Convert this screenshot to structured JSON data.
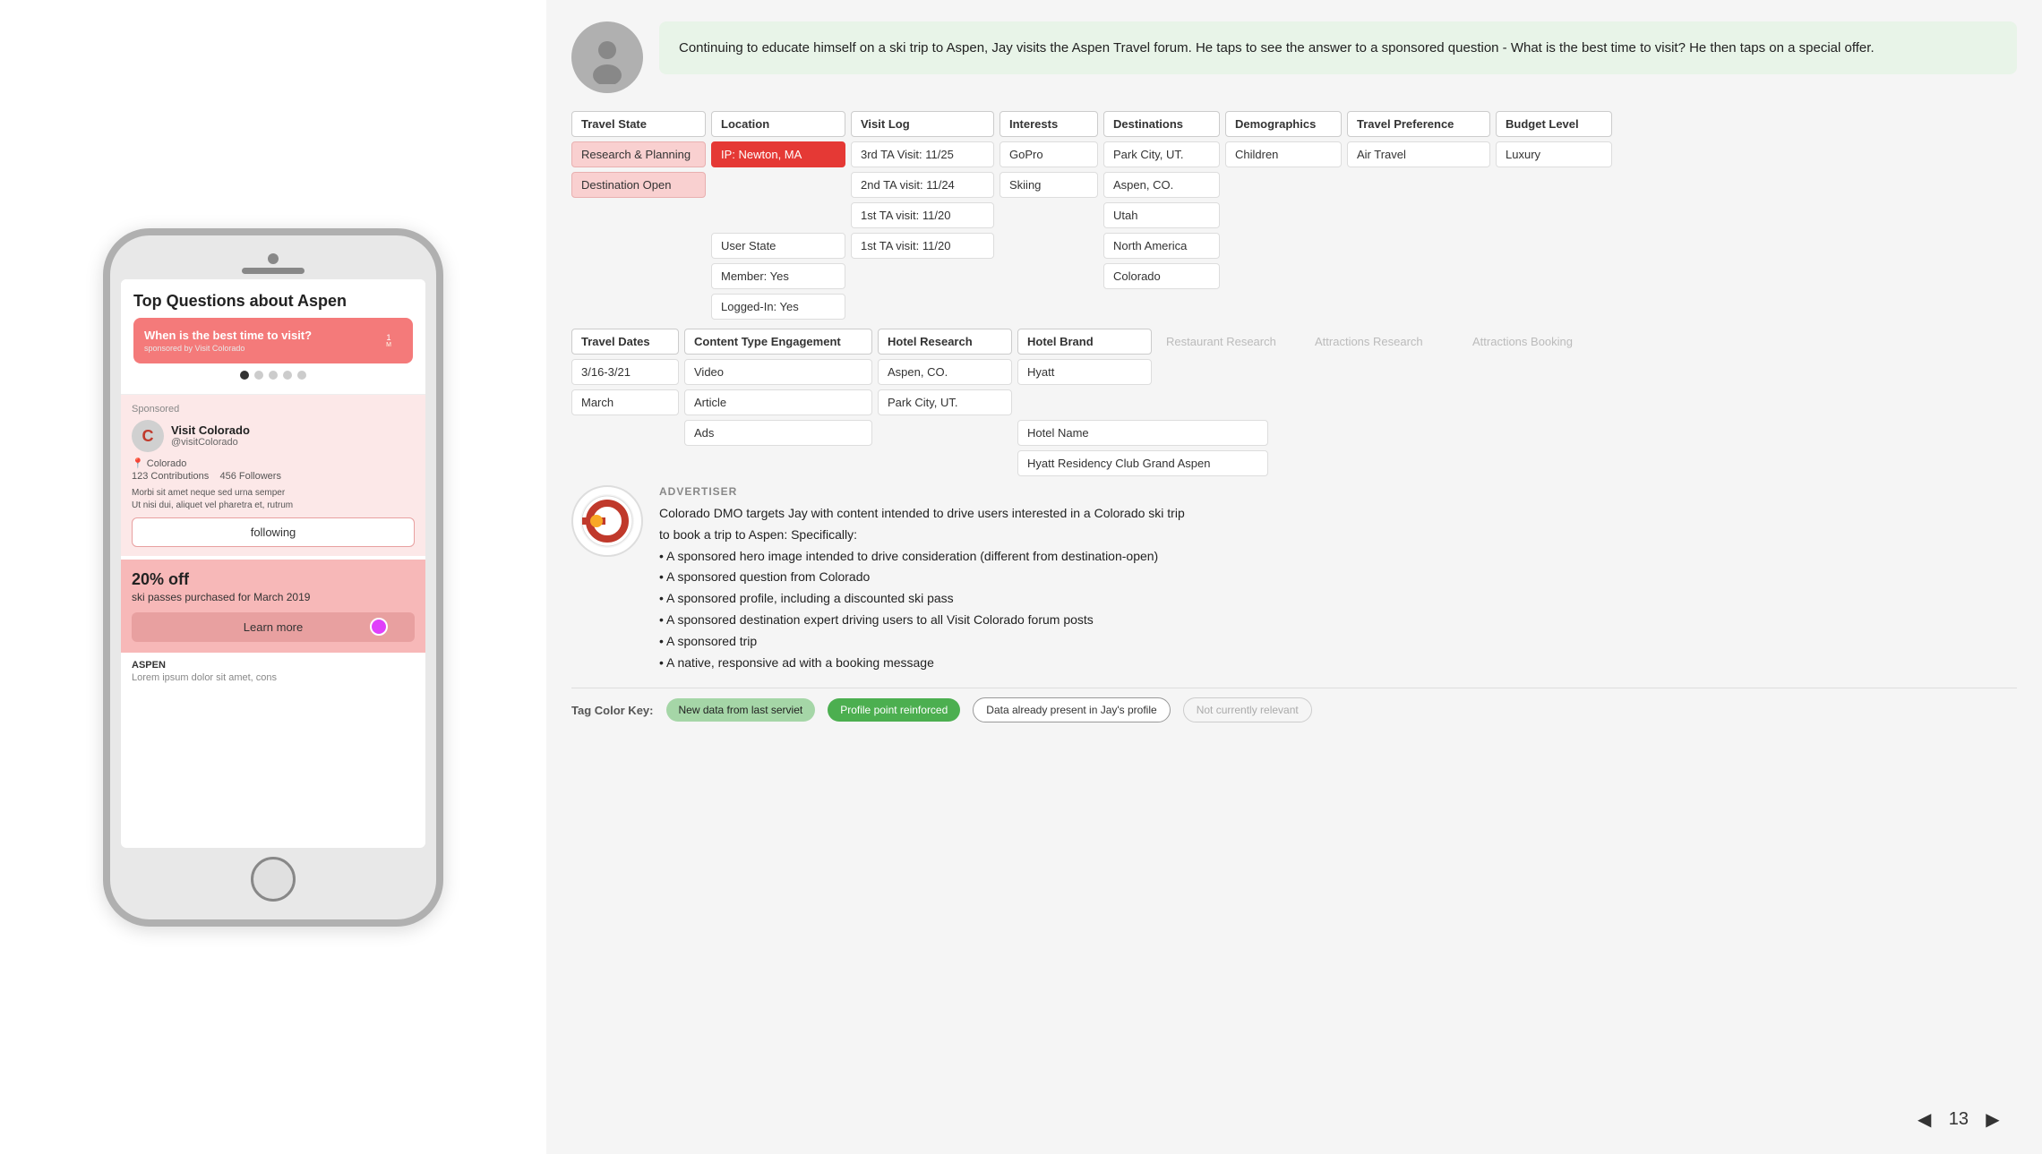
{
  "phone": {
    "screen_title": "Top Questions about Aspen",
    "question_card": {
      "text": "When is the best time to visit?",
      "sponsored_by": "sponsored by Visit Colorado"
    },
    "dots": [
      1,
      2,
      3,
      4,
      5
    ],
    "sponsored_label": "Sponsored",
    "profile": {
      "name": "Visit Colorado",
      "handle": "@visitColorado",
      "location": "Colorado",
      "contributions": "123 Contributions",
      "followers": "456 Followers",
      "desc_line1": "Morbi sit amet neque sed urna semper",
      "desc_line2": "Ut nisi dui, aliquet vel pharetra et, rutrum",
      "follow_btn": "following"
    },
    "offer": {
      "title": "20% off",
      "subtitle": "ski passes purchased for March 2019",
      "cta": "Learn more"
    },
    "aspen": {
      "label": "ASPEN",
      "text": "Lorem ipsum dolor sit amet, cons"
    }
  },
  "narrative": "Continuing to educate himself on a ski trip to Aspen, Jay visits the Aspen Travel forum. He taps to see the answer to a sponsored question - What is the best time to visit? He then taps on a special offer.",
  "profile_headers": [
    "Travel State",
    "Location",
    "Visit Log",
    "Interests",
    "Destinations",
    "Demographics",
    "Travel Preference",
    "Budget Level"
  ],
  "profile_row1": {
    "travel_state": "Research & Planning",
    "location_val": "IP: Newton, MA",
    "visit_log": "3rd TA Visit: 11/25",
    "interests": "GoPro",
    "destinations": "Park City, UT.",
    "demographics": "Children",
    "travel_pref": "Air Travel",
    "budget": "Luxury"
  },
  "profile_row2": {
    "travel_state": "Destination Open",
    "visit_log2": "2nd TA visit: 11/24",
    "interests2": "Skiing",
    "destinations2": "Aspen, CO.",
    "demographics2": "",
    "travel_pref2": "",
    "budget2": ""
  },
  "profile_row3": {
    "visit_log3": "1st TA visit: 11/20",
    "destinations3": "Utah"
  },
  "profile_row4": {
    "misc1": "User State",
    "misc1_val": "",
    "destinations4": "North America"
  },
  "profile_row5": {
    "misc2": "Member: Yes",
    "destinations5": "Colorado"
  },
  "profile_row6": {
    "misc3": "Logged-In: Yes"
  },
  "bottom_headers": [
    "Travel Dates",
    "Content Type Engagement",
    "Hotel Research",
    "Hotel Brand",
    "Restaurant Research",
    "Attractions Research",
    "Attractions Booking"
  ],
  "bottom_row1": {
    "dates": "3/16-3/21",
    "content": "Video",
    "hotel_research": "Aspen, CO.",
    "hotel_brand": "Hyatt",
    "restaurant": "",
    "attractions": "",
    "att_booking": ""
  },
  "bottom_row2": {
    "dates": "March",
    "content": "Article",
    "hotel_research": "Park City, UT.",
    "hotel_brand": "",
    "restaurant": "",
    "attractions": "",
    "att_booking": ""
  },
  "bottom_row3": {
    "content": "Ads",
    "hotel_name_label": "Hotel Name",
    "hotel_name_val": "Hyatt Residency Club Grand Aspen"
  },
  "advertiser": {
    "label": "ADVERTISER",
    "desc_line1": "Colorado DMO targets Jay with content intended to drive users interested in a Colorado ski trip",
    "desc_line2": "to book a trip to Aspen: Specifically:",
    "bullets": [
      "A sponsored hero image intended to drive consideration (different from destination-open)",
      "A sponsored question from Colorado",
      "A sponsored profile, including a discounted ski pass",
      "A sponsored destination expert driving users to all Visit Colorado forum posts",
      "A sponsored trip",
      "A native, responsive ad with a booking message"
    ]
  },
  "legend": {
    "label": "Tag Color Key:",
    "items": [
      {
        "text": "New data from last serviet",
        "class": "legend-new"
      },
      {
        "text": "Profile point reinforced",
        "class": "legend-reinforced"
      },
      {
        "text": "Data already present in Jay's profile",
        "class": "legend-existing"
      },
      {
        "text": "Not currently relevant",
        "class": "legend-not-relevant"
      }
    ]
  },
  "pagination": {
    "page": "13"
  }
}
